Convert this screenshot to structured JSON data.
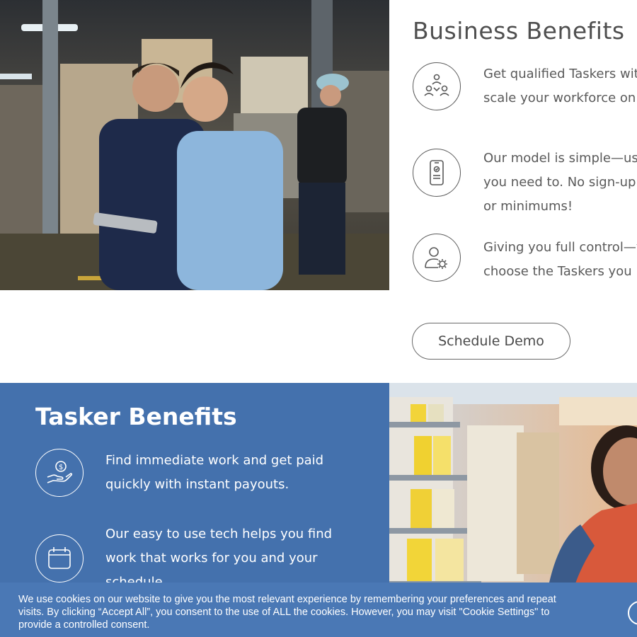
{
  "business": {
    "title": "Business Benefits",
    "benefits": [
      {
        "icon": "team-network-icon",
        "text": "Get qualified Taskers wit\nscale your workforce on"
      },
      {
        "icon": "phone-checklist-icon",
        "text": "Our model is simple—us\nyou need to. No sign-up\nor minimums!"
      },
      {
        "icon": "person-gear-icon",
        "text": "Giving you full control—y\nchoose the Taskers you"
      }
    ],
    "cta": "Schedule Demo"
  },
  "tasker": {
    "title": "Tasker Benefits",
    "benefits": [
      {
        "icon": "hand-money-icon",
        "text": "Find immediate work and get paid quickly with instant payouts."
      },
      {
        "icon": "calendar-icon",
        "text": "Our easy to use tech helps you find work that works for you and your schedule."
      }
    ]
  },
  "cookie": {
    "text": "We use cookies on our website to give you the most relevant experience by remembering your preferences and repeat visits. By clicking “Accept All”, you consent to the use of ALL the cookies. However, you may visit \"Cookie Settings\" to provide a controlled consent."
  },
  "colors": {
    "tasker_bg": "#4471ad",
    "cookie_bg": "#4a78b5",
    "text_gray": "#5a5a5a"
  }
}
